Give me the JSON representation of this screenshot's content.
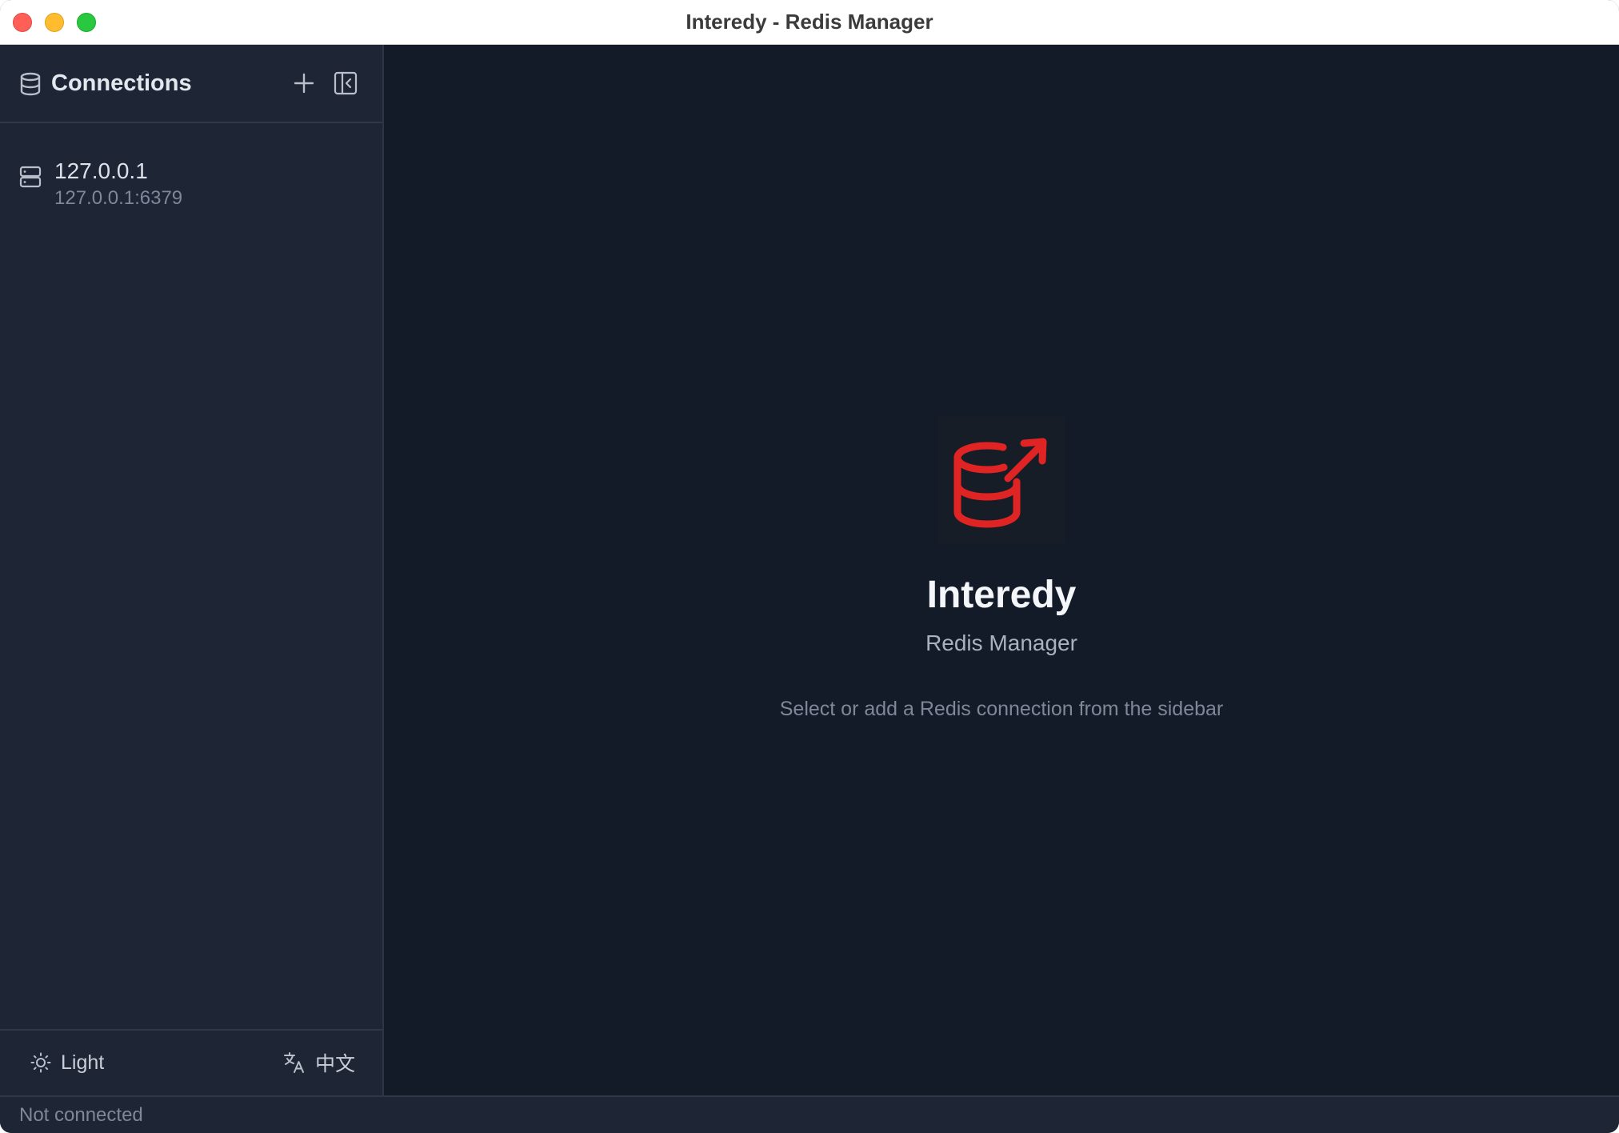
{
  "window": {
    "title": "Interedy - Redis Manager"
  },
  "sidebar": {
    "header": {
      "title": "Connections",
      "icon": "database-icon",
      "add_icon": "plus-icon",
      "collapse_icon": "sidebar-collapse-icon"
    },
    "connections": [
      {
        "name": "127.0.0.1",
        "address": "127.0.0.1:6379",
        "icon": "server-icon"
      }
    ],
    "footer": {
      "theme_label": "Light",
      "theme_icon": "sun-icon",
      "language_label": "中文",
      "language_icon": "translate-icon"
    }
  },
  "main": {
    "logo_icon": "redis-database-arrow-logo",
    "app_name": "Interedy",
    "subtitle": "Redis Manager",
    "hint": "Select or add a Redis connection from the sidebar"
  },
  "statusbar": {
    "status": "Not connected"
  },
  "colors": {
    "brand_red": "#e02424",
    "sidebar_bg": "#1e2636",
    "main_bg": "#131a28"
  }
}
